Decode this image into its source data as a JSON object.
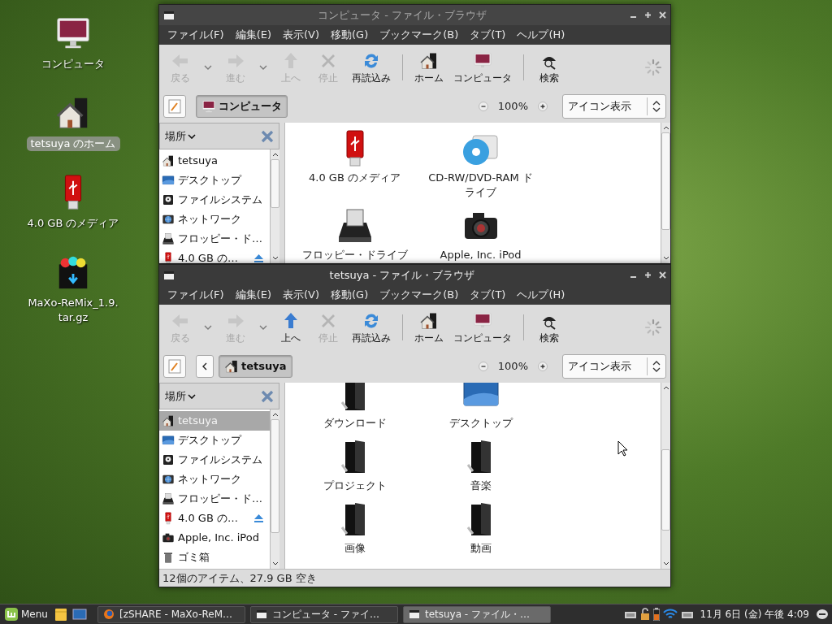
{
  "desktop_icons": [
    {
      "label": "コンピュータ",
      "kind": "computer",
      "selected": false
    },
    {
      "label": "tetsuya のホーム",
      "kind": "home",
      "selected": true
    },
    {
      "label": "4.0 GB のメディア",
      "kind": "usb",
      "selected": false
    },
    {
      "label": "MaXo-ReMix_1.9.tar.gz",
      "kind": "archive",
      "selected": false
    }
  ],
  "windows": [
    {
      "title": "コンピュータ - ファイル・ブラウザ",
      "active": false,
      "menu": [
        "ファイル(F)",
        "編集(E)",
        "表示(V)",
        "移動(G)",
        "ブックマーク(B)",
        "タブ(T)",
        "ヘルプ(H)"
      ],
      "toolbar": [
        [
          {
            "label": "戻る",
            "kind": "back",
            "disabled": true,
            "dropdown": true
          },
          {
            "label": "進む",
            "kind": "forward",
            "disabled": true,
            "dropdown": true
          },
          {
            "label": "上へ",
            "kind": "up",
            "disabled": true,
            "dropdown": false
          },
          {
            "label": "停止",
            "kind": "stop",
            "disabled": true,
            "dropdown": false
          },
          {
            "label": "再読込み",
            "kind": "reload",
            "disabled": false,
            "dropdown": false
          }
        ],
        [
          {
            "label": "ホーム",
            "kind": "home",
            "disabled": false,
            "dropdown": false
          },
          {
            "label": "コンピュータ",
            "kind": "computer",
            "disabled": false,
            "dropdown": false
          }
        ],
        [
          {
            "label": "検索",
            "kind": "search",
            "disabled": false,
            "dropdown": false
          }
        ]
      ],
      "path_back": false,
      "path": {
        "label": "コンピュータ",
        "kind": "computer"
      },
      "zoom": "100%",
      "view_mode": "アイコン表示",
      "sidebar": {
        "header": "場所",
        "items": [
          {
            "label": "tetsuya",
            "kind": "home",
            "selected": false,
            "eject": false
          },
          {
            "label": "デスクトップ",
            "kind": "desktop",
            "selected": false,
            "eject": false
          },
          {
            "label": "ファイルシステム",
            "kind": "filesystem",
            "selected": false,
            "eject": false
          },
          {
            "label": "ネットワーク",
            "kind": "network",
            "selected": false,
            "eject": false
          },
          {
            "label": "フロッピー・ド…",
            "kind": "floppy",
            "selected": false,
            "eject": false
          },
          {
            "label": "4.0 GB の…",
            "kind": "usb",
            "selected": false,
            "eject": true
          }
        ]
      },
      "files": [
        {
          "label": "4.0 GB のメディア",
          "kind": "usb"
        },
        {
          "label": "CD-RW/DVD-RAM ドライブ",
          "kind": "cdrom"
        },
        {
          "label": "フロッピー・ドライブ",
          "kind": "floppy"
        },
        {
          "label": "Apple, Inc. iPod",
          "kind": "camera"
        }
      ]
    },
    {
      "title": "tetsuya - ファイル・ブラウザ",
      "active": true,
      "menu": [
        "ファイル(F)",
        "編集(E)",
        "表示(V)",
        "移動(G)",
        "ブックマーク(B)",
        "タブ(T)",
        "ヘルプ(H)"
      ],
      "toolbar": [
        [
          {
            "label": "戻る",
            "kind": "back",
            "disabled": true,
            "dropdown": true
          },
          {
            "label": "進む",
            "kind": "forward",
            "disabled": true,
            "dropdown": true
          },
          {
            "label": "上へ",
            "kind": "up",
            "disabled": false,
            "dropdown": false
          },
          {
            "label": "停止",
            "kind": "stop",
            "disabled": true,
            "dropdown": false
          },
          {
            "label": "再読込み",
            "kind": "reload",
            "disabled": false,
            "dropdown": false
          }
        ],
        [
          {
            "label": "ホーム",
            "kind": "home",
            "disabled": false,
            "dropdown": false
          },
          {
            "label": "コンピュータ",
            "kind": "computer",
            "disabled": false,
            "dropdown": false
          }
        ],
        [
          {
            "label": "検索",
            "kind": "search",
            "disabled": false,
            "dropdown": false
          }
        ]
      ],
      "path_back": true,
      "path": {
        "label": "tetsuya",
        "kind": "home"
      },
      "zoom": "100%",
      "view_mode": "アイコン表示",
      "sidebar": {
        "header": "場所",
        "items": [
          {
            "label": "tetsuya",
            "kind": "home",
            "selected": true,
            "eject": false
          },
          {
            "label": "デスクトップ",
            "kind": "desktop",
            "selected": false,
            "eject": false
          },
          {
            "label": "ファイルシステム",
            "kind": "filesystem",
            "selected": false,
            "eject": false
          },
          {
            "label": "ネットワーク",
            "kind": "network",
            "selected": false,
            "eject": false
          },
          {
            "label": "フロッピー・ド…",
            "kind": "floppy",
            "selected": false,
            "eject": false
          },
          {
            "label": "4.0 GB の…",
            "kind": "usb",
            "selected": false,
            "eject": true
          },
          {
            "label": "Apple, Inc. iPod",
            "kind": "camera",
            "selected": false,
            "eject": false
          },
          {
            "label": "ゴミ箱",
            "kind": "trash",
            "selected": false,
            "eject": false
          }
        ]
      },
      "files": [
        {
          "label": "ダウンロード",
          "kind": "folder"
        },
        {
          "label": "デスクトップ",
          "kind": "desktop"
        },
        {
          "label": "プロジェクト",
          "kind": "folder"
        },
        {
          "label": "音楽",
          "kind": "folder"
        },
        {
          "label": "画像",
          "kind": "folder"
        },
        {
          "label": "動画",
          "kind": "folder"
        }
      ],
      "status": "12個のアイテム、27.9 GB 空き"
    }
  ],
  "taskbar": {
    "menu_label": "Menu",
    "tasks": [
      {
        "label": "[zSHARE - MaXo-ReM…",
        "kind": "browser",
        "selected": false
      },
      {
        "label": "コンピュータ - ファイ…",
        "kind": "window",
        "selected": false
      },
      {
        "label": "tetsuya - ファイル・…",
        "kind": "window",
        "selected": true
      }
    ],
    "clock": "11月 6日 (金) 午後 4:09"
  }
}
